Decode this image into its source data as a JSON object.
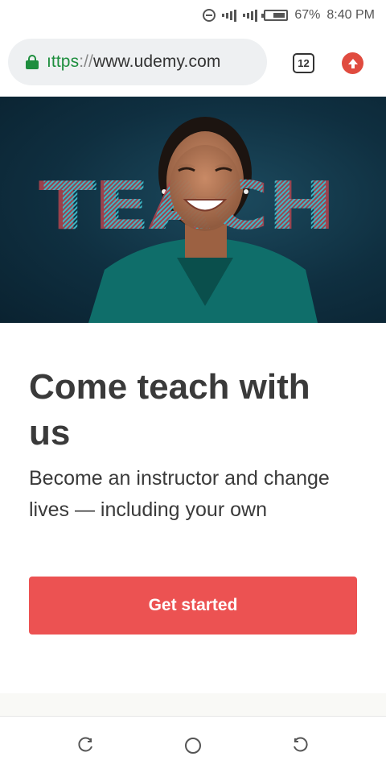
{
  "status_bar": {
    "battery": "67%",
    "time": "8:40 PM",
    "icons": [
      "do-not-disturb-icon",
      "signal-icon",
      "signal-icon",
      "battery-icon"
    ]
  },
  "browser": {
    "url_scheme": "ıttps",
    "url_separator": "://",
    "url_host": "www.udemy.com",
    "tab_count": "12",
    "icons": [
      "lock-icon",
      "tabs-icon",
      "update-icon"
    ]
  },
  "hero": {
    "overlay_word": "TEACH"
  },
  "content": {
    "headline": "Come teach with us",
    "subhead": "Become an instructor and change lives — including your own",
    "cta_label": "Get started"
  },
  "nav": {
    "icons": [
      "back-icon",
      "home-icon",
      "recents-icon"
    ]
  },
  "colors": {
    "accent": "#ec5252",
    "secure_green": "#1e8e3e",
    "hero_bg": "#0f2f40",
    "text": "#3a3a3a"
  }
}
